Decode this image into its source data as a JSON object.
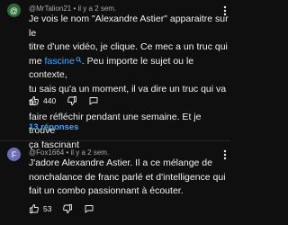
{
  "comments": [
    {
      "avatar_letter": "@",
      "avatar_color": "#2f6b36",
      "meta": "@MrTalion21 • il y a 2 sem.",
      "lines": [
        "Je vois le nom \"Alexandre Astier\" apparaitre sur le",
        "titre d'une vidéo, je clique. Ce mec a un truc qui",
        ". Peu importe le sujet ou le contexte,",
        "tu sais qu'a un moment, il va dire un truc qui va te",
        "faire réfléchir pendant une semaine. Et je trouve",
        "ça fascinant"
      ],
      "line3_prefix": "me ",
      "link_text": "fascine",
      "likes": "440",
      "replies": "13 réponses"
    },
    {
      "avatar_letter": "F",
      "avatar_color": "#6c6fb5",
      "meta": "@Fox1664 • il y a 2 sem.",
      "lines": [
        "J'adore Alexandre Astier. Il a ce mélange de",
        "nonchalance de franc parlé et d'intelligence qui",
        "fait un combo passionnant à écouter."
      ],
      "likes": "53"
    }
  ]
}
